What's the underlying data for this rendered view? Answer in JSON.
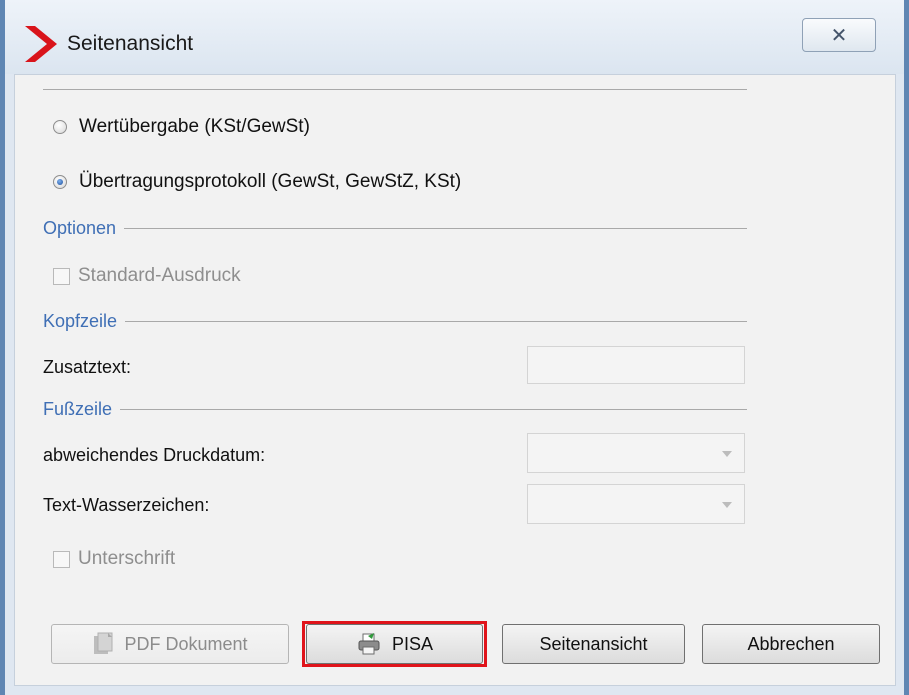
{
  "window": {
    "title": "Seitenansicht",
    "close_glyph": "✕",
    "logo_icon": "red-chevron-logo",
    "frame_color": "#5f86b3"
  },
  "report_type": {
    "options": [
      {
        "label": "Wertübergabe (KSt/GewSt)",
        "selected": false
      },
      {
        "label": "Übertragungsprotokoll (GewSt, GewStZ, KSt)",
        "selected": true
      }
    ]
  },
  "optionen": {
    "heading": "Optionen",
    "standard_ausdruck": {
      "label": "Standard-Ausdruck",
      "checked": false,
      "enabled": false
    }
  },
  "kopfzeile": {
    "heading": "Kopfzeile",
    "zusatztext_label": "Zusatztext:",
    "zusatztext_value": ""
  },
  "fusszeile": {
    "heading": "Fußzeile",
    "druckdatum_label": "abweichendes Druckdatum:",
    "druckdatum_value": "",
    "wasserzeichen_label": "Text-Wasserzeichen:",
    "wasserzeichen_value": "",
    "unterschrift": {
      "label": "Unterschrift",
      "checked": false,
      "enabled": false
    }
  },
  "buttons": {
    "pdf": {
      "label": "PDF Dokument",
      "icon": "pdf-document-icon",
      "enabled": false
    },
    "pisa": {
      "label": "PISA",
      "icon": "printer-icon",
      "enabled": true,
      "highlight_color": "#e0141b"
    },
    "seitenansicht": {
      "label": "Seitenansicht",
      "enabled": true
    },
    "abbrechen": {
      "label": "Abbrechen",
      "enabled": true
    }
  },
  "colors": {
    "section_heading": "#3f6fb5",
    "highlight": "#e0141b"
  }
}
